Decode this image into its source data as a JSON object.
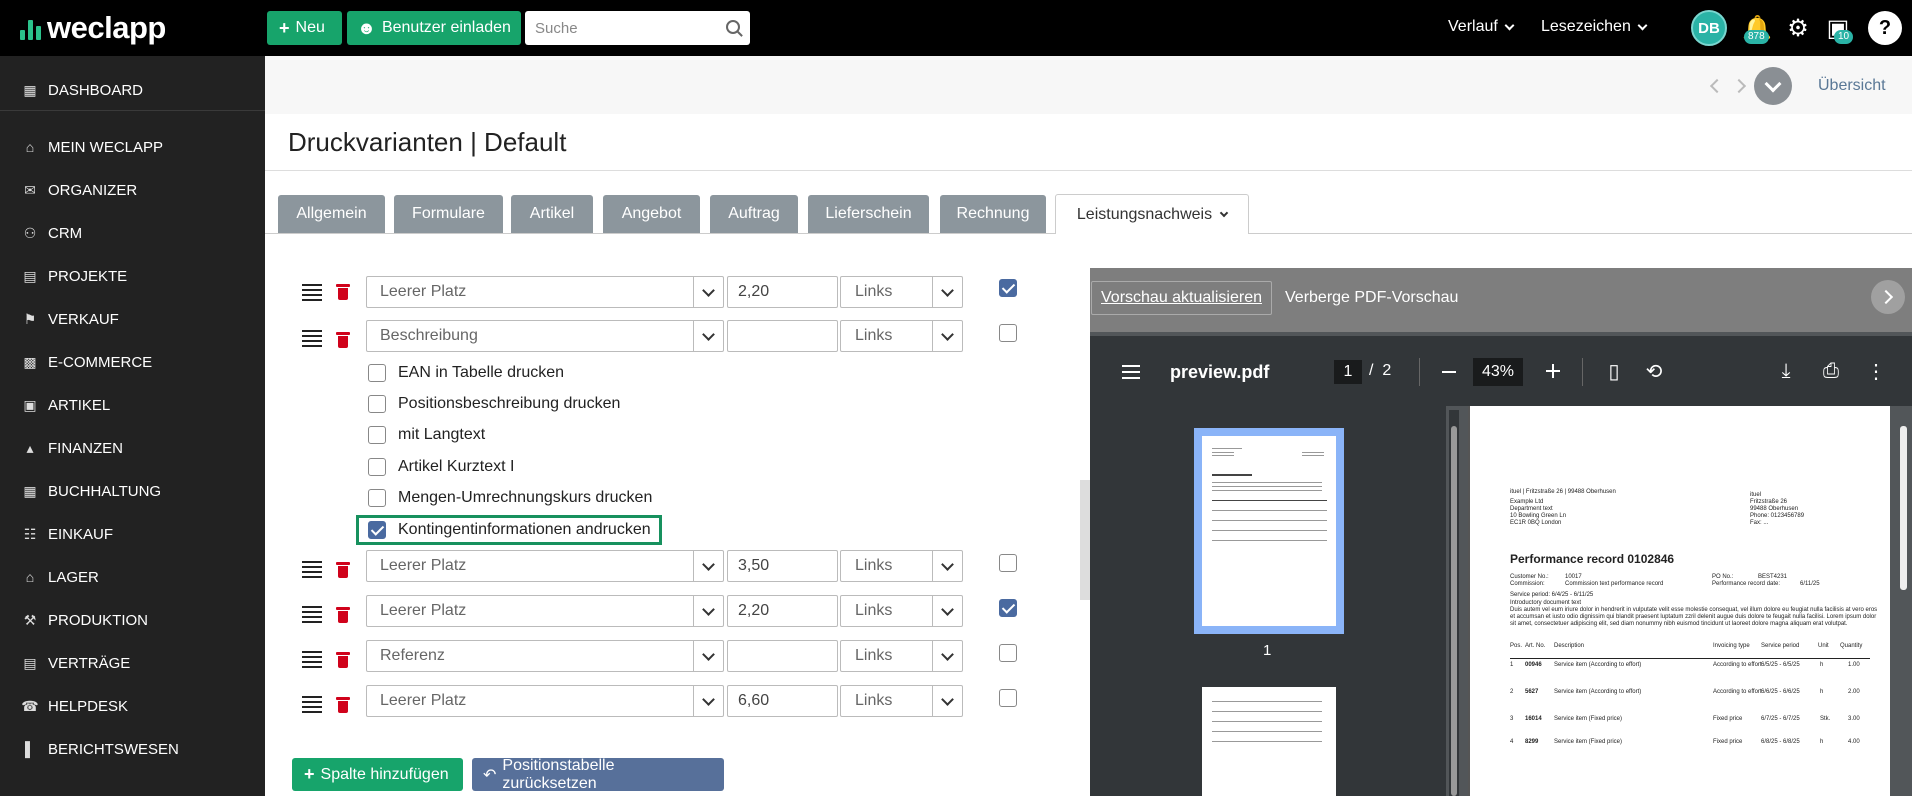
{
  "topbar": {
    "logo_text": "weclapp",
    "new_label": "Neu",
    "invite_label": "Benutzer einladen",
    "search_placeholder": "Suche",
    "history_label": "Verlauf",
    "bookmarks_label": "Lesezeichen",
    "avatar_initials": "DB",
    "notifications_count": "878",
    "messages_count": "10",
    "help_label": "?"
  },
  "sidebar": {
    "items": [
      {
        "label": "DASHBOARD",
        "icon": "dashboard-icon"
      },
      {
        "label": "MEIN WECLAPP",
        "icon": "home-icon"
      },
      {
        "label": "ORGANIZER",
        "icon": "mail-icon"
      },
      {
        "label": "CRM",
        "icon": "users-icon"
      },
      {
        "label": "PROJEKTE",
        "icon": "briefcase-icon"
      },
      {
        "label": "VERKAUF",
        "icon": "tag-icon"
      },
      {
        "label": "E-COMMERCE",
        "icon": "shop-icon"
      },
      {
        "label": "ARTIKEL",
        "icon": "box-icon"
      },
      {
        "label": "FINANZEN",
        "icon": "bank-icon"
      },
      {
        "label": "BUCHHALTUNG",
        "icon": "calculator-icon"
      },
      {
        "label": "EINKAUF",
        "icon": "cart-icon"
      },
      {
        "label": "LAGER",
        "icon": "warehouse-icon"
      },
      {
        "label": "PRODUKTION",
        "icon": "wrench-icon"
      },
      {
        "label": "VERTRÄGE",
        "icon": "contract-icon"
      },
      {
        "label": "HELPDESK",
        "icon": "headset-icon"
      },
      {
        "label": "BERICHTSWESEN",
        "icon": "chart-icon"
      }
    ]
  },
  "header": {
    "overview_label": "Übersicht",
    "title": "Druckvarianten | Default"
  },
  "tabs": [
    {
      "label": "Allgemein"
    },
    {
      "label": "Formulare"
    },
    {
      "label": "Artikel"
    },
    {
      "label": "Angebot"
    },
    {
      "label": "Auftrag"
    },
    {
      "label": "Lieferschein"
    },
    {
      "label": "Rechnung"
    },
    {
      "label": "Leistungsnachweis",
      "active": true
    }
  ],
  "rows": [
    {
      "type": "Leerer Platz",
      "width": "2,20",
      "align": "Links",
      "checked": true
    },
    {
      "type": "Beschreibung",
      "width": "",
      "align": "Links",
      "checked": false
    },
    {
      "type": "Leerer Platz",
      "width": "3,50",
      "align": "Links",
      "checked": false
    },
    {
      "type": "Leerer Platz",
      "width": "2,20",
      "align": "Links",
      "checked": true
    },
    {
      "type": "Referenz",
      "width": "",
      "align": "Links",
      "checked": false
    },
    {
      "type": "Leerer Platz",
      "width": "6,60",
      "align": "Links",
      "checked": false
    }
  ],
  "options": [
    {
      "label": "EAN in Tabelle drucken",
      "checked": false
    },
    {
      "label": "Positionsbeschreibung drucken",
      "checked": false
    },
    {
      "label": "mit Langtext",
      "checked": false
    },
    {
      "label": "Artikel Kurztext I",
      "checked": false
    },
    {
      "label": "Mengen-Umrechnungskurs drucken",
      "checked": false
    },
    {
      "label": "Kontingentinformationen andrucken",
      "checked": true
    }
  ],
  "actions": {
    "add_column": "Spalte hinzufügen",
    "reset_table": "Positionstabelle zurücksetzen"
  },
  "pdf": {
    "refresh_label": "Vorschau aktualisieren",
    "hide_label": "Verberge PDF-Vorschau",
    "filename": "preview.pdf",
    "current_page": "1",
    "page_sep": "/",
    "total_pages": "2",
    "zoom": "43%",
    "thumb_label": "1",
    "doc": {
      "sender_line": "ituel | Fritzstraße 26 | 99488 Oberhusen",
      "recipient": [
        "Example Ltd",
        "Department text",
        "10 Bowling Green Ln",
        "EC1R 0BQ London"
      ],
      "company": [
        "ituel",
        "Fritzstraße 26",
        "99488 Oberhusen",
        "Phone: 0123456789",
        "Fax: ..."
      ],
      "title": "Performance record 0102846",
      "meta": [
        {
          "label": "Customer No.:",
          "value": "10017",
          "label2": "PO No.:",
          "value2": "BEST4231"
        },
        {
          "label": "Commission:",
          "value": "Commission text performance record",
          "label2": "Performance record date:",
          "value2": "6/11/25"
        }
      ],
      "service_period": "Service period: 6/4/25 - 6/11/25",
      "intro_title": "Introductory document text",
      "intro_text": [
        "Duis autem vel eum iriure dolor in hendrerit in vulputate velit esse molestie consequat, vel illum dolore eu feugiat nulla facilisis at vero eros",
        "et accumsan et iusto odio dignissim qui blandit praesent luptatum zzril delenit augue duis dolore te feugait nulla facilisi. Lorem ipsum dolor",
        "sit amet, consectetuer adipiscing elit, sed diam nonummy nibh euismod tincidunt ut laoreet dolore magna aliquam erat volutpat."
      ],
      "table_headers": [
        "Pos.",
        "Art. No.",
        "Description",
        "Invoicing type",
        "Service period",
        "Unit",
        "Quantity"
      ],
      "table_rows": [
        {
          "pos": "1",
          "art": "00946",
          "desc": "Service item (According to effort)",
          "type": "According to effort",
          "period": "6/5/25 - 6/5/25",
          "unit": "h",
          "qty": "1.00"
        },
        {
          "pos": "2",
          "art": "5627",
          "desc": "Service item (According to effort)",
          "type": "According to effort",
          "period": "6/6/25 - 6/6/25",
          "unit": "h",
          "qty": "2.00"
        },
        {
          "pos": "3",
          "art": "16014",
          "desc": "Service item (Fixed price)",
          "type": "Fixed price",
          "period": "6/7/25 - 6/7/25",
          "unit": "Stk.",
          "qty": "3.00"
        },
        {
          "pos": "4",
          "art": "8299",
          "desc": "Service item (Fixed price)",
          "type": "Fixed price",
          "period": "6/8/25 - 6/8/25",
          "unit": "h",
          "qty": "4.00"
        }
      ]
    }
  }
}
